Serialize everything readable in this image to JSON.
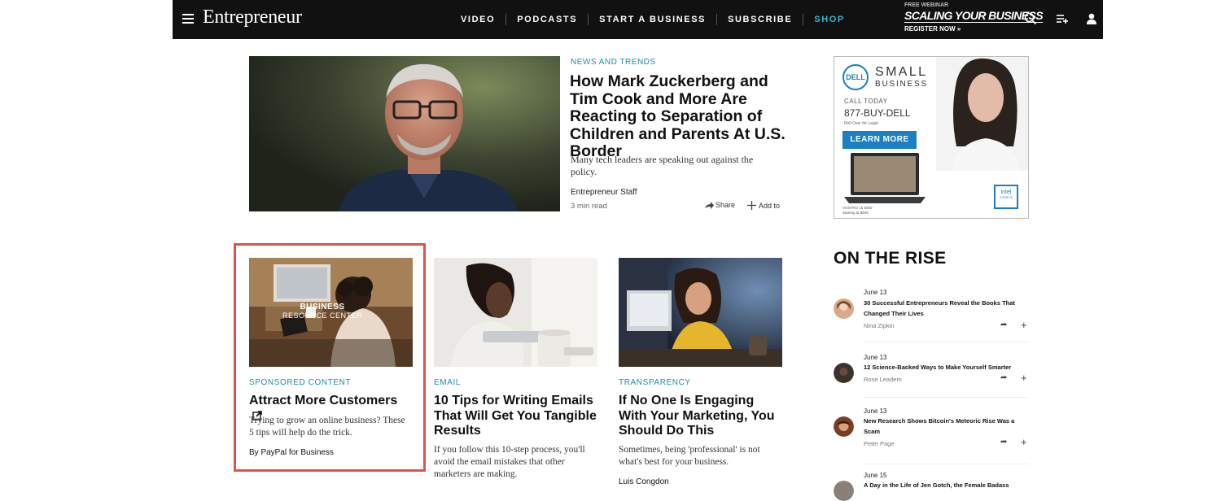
{
  "nav": {
    "logo": "Entrepreneur",
    "links": [
      "VIDEO",
      "PODCASTS",
      "START A BUSINESS",
      "SUBSCRIBE",
      "SHOP"
    ],
    "promo": {
      "line1": "FREE WEBINAR",
      "line2": "SCALING YOUR BUSINESS",
      "line3": "REGISTER NOW »"
    },
    "icons": [
      "search-icon",
      "playlist-add-icon",
      "user-icon"
    ]
  },
  "hero": {
    "category": "NEWS AND TRENDS",
    "title": "How Mark Zuckerberg and Tim Cook and More Are Reacting to Separation of Children and Parents At U.S. Border",
    "description": "Many tech leaders are speaking out against the policy.",
    "author": "Entrepreneur Staff",
    "read_time": "3 min read",
    "share_label": "Share",
    "add_label": "Add to"
  },
  "cards": [
    {
      "image_caption_1": "BUSINESS",
      "image_caption_2": "RESOURCE CENTER",
      "category": "SPONSORED CONTENT",
      "title": "Attract More Customers",
      "description": "Trying to grow an online business? These 5 tips will help do the trick.",
      "byline": "By PayPal for Business",
      "highlighted": true
    },
    {
      "category": "EMAIL",
      "title": "10 Tips for Writing Emails That Will Get You Tangible Results",
      "description": "If you follow this 10-step process, you'll avoid the email mistakes that other marketers are making."
    },
    {
      "category": "TRANSPARENCY",
      "title": "If No One Is Engaging With Your Marketing, You Should Do This",
      "description": "Sometimes, being 'professional' is not what's best for your business.",
      "byline": "Luis Congdon"
    }
  ],
  "ad": {
    "brand": "DELL",
    "headline_1": "SMALL",
    "headline_2": "BUSINESS",
    "call": "CALL TODAY",
    "phone": "877-BUY-DELL",
    "fine_print": "Roll Over for Legal",
    "cta": "LEARN MORE",
    "price_1": "VOSTRO 15 5000",
    "price_2": "Starting at $549",
    "chip_1": "intel",
    "chip_2": "CORE i5"
  },
  "rise": {
    "heading": "ON THE RISE",
    "items": [
      {
        "date": "June 13",
        "title": "30 Successful Entrepreneurs Reveal the Books That Changed Their Lives",
        "author": "Nina Zipkin"
      },
      {
        "date": "June 13",
        "title": "12 Science-Backed Ways to Make Yourself Smarter",
        "author": "Rose Leadem"
      },
      {
        "date": "June 13",
        "title": "New Research Shows Bitcoin's Meteoric Rise Was a Scam",
        "author": "Peter Page"
      },
      {
        "date": "June 15",
        "title": "A Day in the Life of Jen Gotch, the Female Badass"
      }
    ]
  },
  "colors": {
    "nav_bg": "#111111",
    "accent_link": "#1f8ea8",
    "shop": "#3bb3d4",
    "highlight": "#d9574a",
    "dell_blue": "#1b7fc4"
  }
}
